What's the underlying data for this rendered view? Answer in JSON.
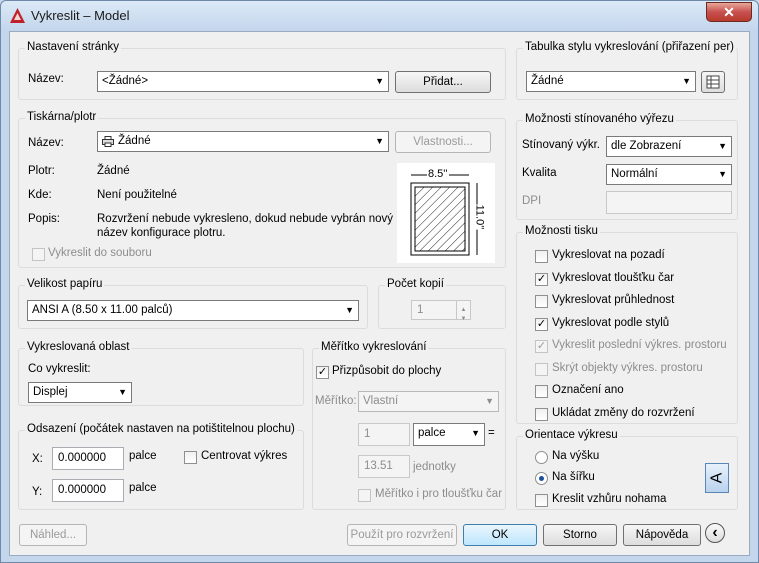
{
  "window": {
    "title": "Vykreslit – Model",
    "close_glyph": "✕"
  },
  "page_setup": {
    "group": "Nastavení stránky",
    "name_label": "Název:",
    "name_value": "<Žádné>",
    "add_button": "Přidat..."
  },
  "printer": {
    "group": "Tiskárna/plotr",
    "name_label": "Název:",
    "name_value": "Žádné",
    "properties_button": "Vlastnosti...",
    "plotter_label": "Plotr:",
    "plotter_value": "Žádné",
    "where_label": "Kde:",
    "where_value": "Není použitelné",
    "desc_label": "Popis:",
    "desc_line1": "Rozvržení nebude vykresleno, dokud nebude vybrán nový",
    "desc_line2": "název konfigurace plotru.",
    "plot_to_file": "Vykreslit do souboru",
    "preview_width": "8.5''",
    "preview_height": "11.0''"
  },
  "paper_size": {
    "group": "Velikost papíru",
    "value": "ANSI A (8.50 x 11.00 palců)"
  },
  "copies": {
    "group": "Počet kopií",
    "value": "1"
  },
  "plot_area": {
    "group": "Vykreslovaná oblast",
    "what_label": "Co vykreslit:",
    "what_value": "Displej"
  },
  "offset": {
    "group": "Odsazení (počátek nastaven na potištitelnou plochu)",
    "x_label": "X:",
    "x_value": "0.000000",
    "x_unit": "palce",
    "y_label": "Y:",
    "y_value": "0.000000",
    "y_unit": "palce",
    "center": "Centrovat výkres"
  },
  "scale": {
    "group": "Měřítko vykreslování",
    "fit": "Přizpůsobit do plochy",
    "scale_label": "Měřítko:",
    "scale_value": "Vlastní",
    "value1": "1",
    "unit_value": "palce",
    "equals": "=",
    "value2": "13.51",
    "unit2": "jednotky",
    "lineweights": "Měřítko i pro tloušťku čar"
  },
  "style_table": {
    "group": "Tabulka stylu vykreslování (přiřazení per)",
    "value": "Žádné"
  },
  "shaded": {
    "group": "Možnosti stínovaného výřezu",
    "shade_label": "Stínovaný výkr.",
    "shade_value": "dle Zobrazení",
    "quality_label": "Kvalita",
    "quality_value": "Normální",
    "dpi_label": "DPI"
  },
  "options": {
    "group": "Možnosti tisku",
    "items": [
      {
        "label": "Vykreslovat na pozadí",
        "checked": false,
        "disabled": false
      },
      {
        "label": "Vykreslovat tloušťku čar",
        "checked": true,
        "disabled": false
      },
      {
        "label": "Vykreslovat průhlednost",
        "checked": false,
        "disabled": false
      },
      {
        "label": "Vykreslovat podle stylů",
        "checked": true,
        "disabled": false
      },
      {
        "label": "Vykreslit poslední výkres. prostoru",
        "checked": true,
        "disabled": true
      },
      {
        "label": "Skrýt objekty výkres. prostoru",
        "checked": false,
        "disabled": true
      },
      {
        "label": "Označení ano",
        "checked": false,
        "disabled": false
      },
      {
        "label": "Ukládat změny do rozvržení",
        "checked": false,
        "disabled": false
      }
    ]
  },
  "orientation": {
    "group": "Orientace výkresu",
    "portrait": "Na výšku",
    "landscape": "Na šířku",
    "upside_down": "Kreslit vzhůru nohama",
    "icon_letter": "A"
  },
  "footer": {
    "preview": "Náhled...",
    "apply": "Použít pro rozvržení",
    "ok": "OK",
    "cancel": "Storno",
    "help": "Nápověda",
    "more_glyph": "‹"
  },
  "colors": {
    "accent": "#1c4f9c",
    "close": "#c75050"
  }
}
